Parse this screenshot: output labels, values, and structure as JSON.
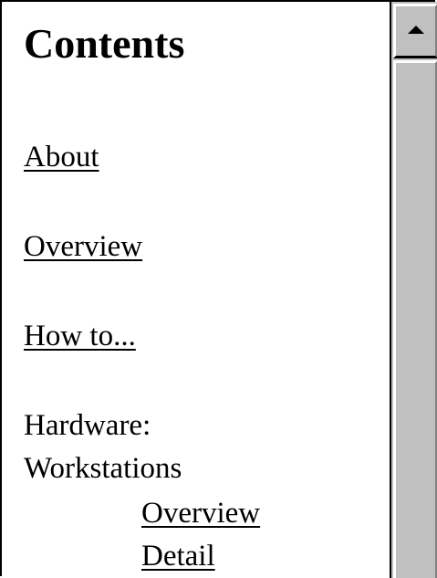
{
  "contents": {
    "title": "Contents",
    "links": {
      "about": "About",
      "overview": "Overview",
      "how_to": "How to..."
    },
    "hardware": {
      "label_line1": "Hardware:",
      "label_line2": "Workstations",
      "sublinks": {
        "overview": "Overview",
        "detail": "Detail"
      }
    }
  },
  "scrollbar": {
    "up_icon": "triangle-up",
    "track_color": "#c0c0c0"
  }
}
